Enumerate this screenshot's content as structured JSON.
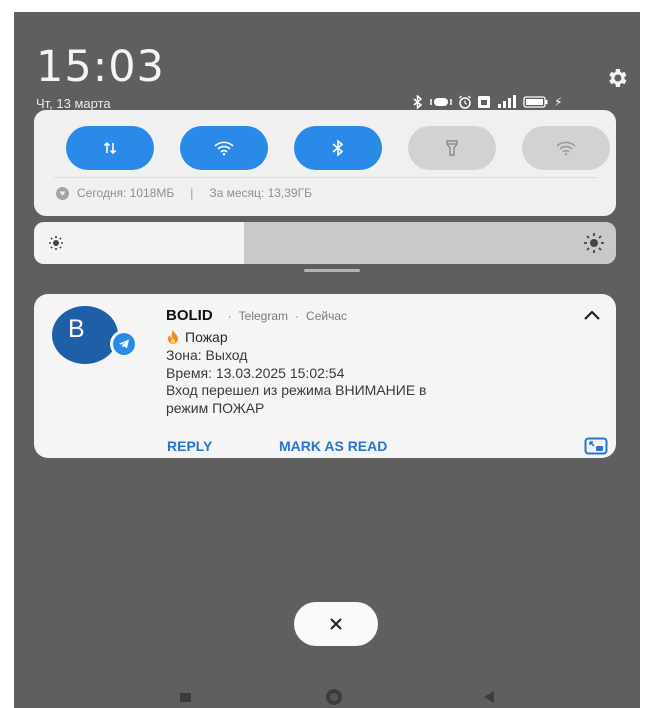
{
  "status_bar": {
    "time": "15:03",
    "date": "Чт, 13 марта",
    "battery": "100"
  },
  "quick_settings": {
    "usage_today": "Сегодня: 1018МБ",
    "usage_separator": "|",
    "usage_month": "За месяц: 13,39ГБ",
    "brightness_level": 0.36
  },
  "notification": {
    "avatar_letter": "B",
    "sender": "BOLID",
    "app": "Telegram",
    "time": "Сейчас",
    "separator": "·",
    "title": "Пожар",
    "lines": [
      "Зона: Выход",
      "Время: 13.03.2025 15:02:54",
      "Вход перешел из режима ВНИМАНИЕ в",
      "режим ПОЖАР"
    ],
    "actions": {
      "reply": "REPLY",
      "mark_as_read": "MARK AS READ"
    }
  },
  "colors": {
    "accent": "#2b8ae8",
    "action_text": "#2775cf",
    "avatar": "#1f5fa8"
  }
}
